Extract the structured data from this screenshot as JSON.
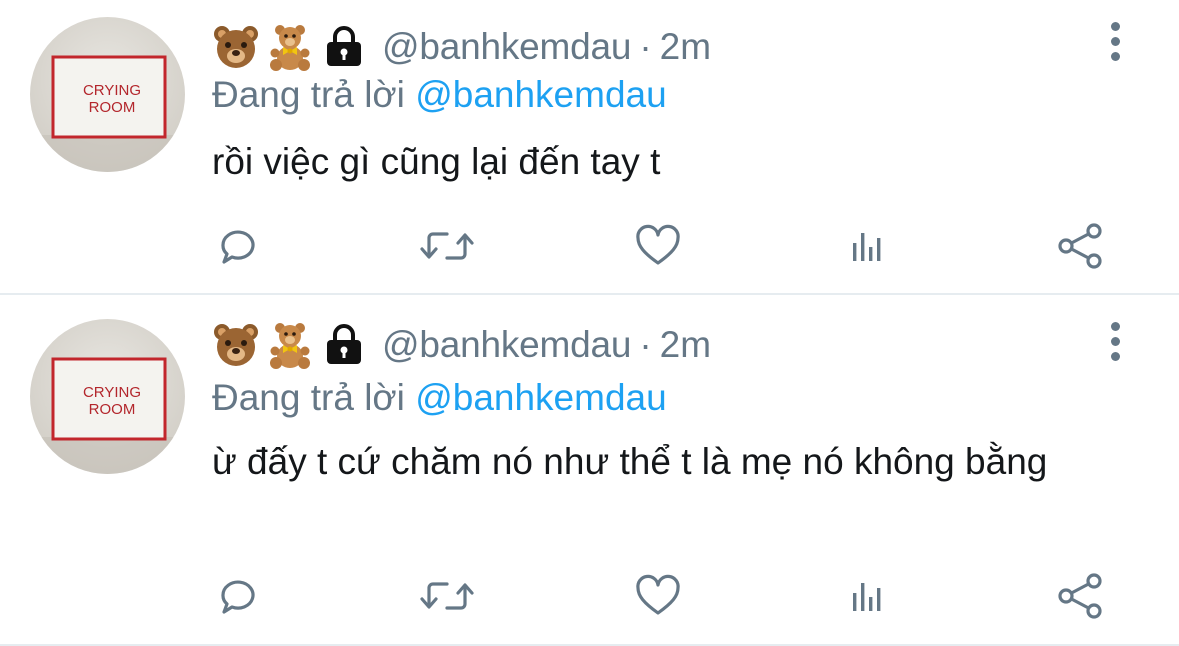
{
  "tweets": [
    {
      "handle": "@banhkemdau",
      "separator": "·",
      "time": "2m",
      "reply_prefix": "Đang trả lời",
      "reply_to": "@banhkemdau",
      "text": "rồi việc gì cũng lại đến tay t",
      "avatar_label_line1": "CRYING",
      "avatar_label_line2": "ROOM"
    },
    {
      "handle": "@banhkemdau",
      "separator": "·",
      "time": "2m",
      "reply_prefix": "Đang trả lời",
      "reply_to": "@banhkemdau",
      "text": "ừ đấy t cứ chăm nó như thể t là mẹ nó không bằng",
      "avatar_label_line1": "CRYING",
      "avatar_label_line2": "ROOM"
    }
  ],
  "icons": {
    "emojis": [
      "bear-face-emoji",
      "teddy-bear-emoji",
      "lock-emoji"
    ],
    "actions": [
      "reply-icon",
      "retweet-icon",
      "like-icon",
      "stats-icon",
      "share-icon"
    ],
    "menu": "more-vertical-icon"
  },
  "colors": {
    "text": "#14171a",
    "secondary": "#657786",
    "mention": "#1da1f2",
    "divider": "#e6ecf0",
    "avatar_border": "#c2262c"
  }
}
